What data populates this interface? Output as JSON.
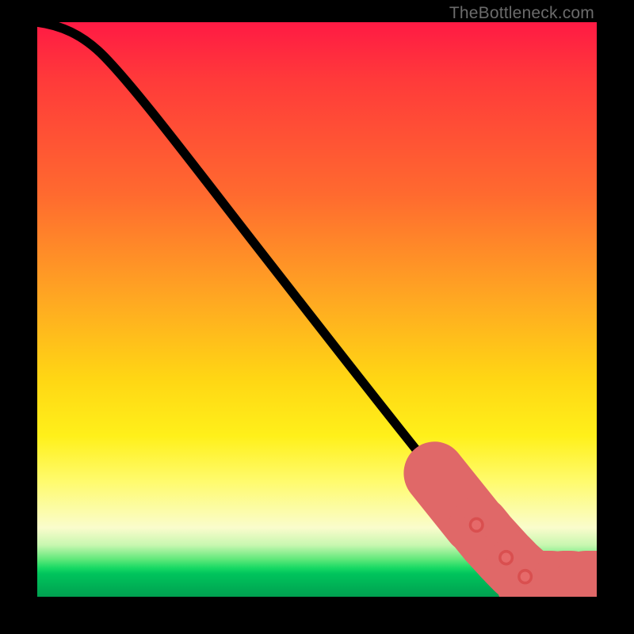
{
  "watermark": "TheBottleneck.com",
  "chart_data": {
    "type": "line",
    "title": "",
    "xlabel": "",
    "ylabel": "",
    "xlim": [
      0,
      100
    ],
    "ylim": [
      0,
      100
    ],
    "grid": false,
    "legend": false,
    "background": "rainbow-gradient-vertical",
    "curve": {
      "name": "bottleneck-curve",
      "points": [
        {
          "x": 0,
          "y": 100
        },
        {
          "x": 5,
          "y": 99
        },
        {
          "x": 10,
          "y": 96
        },
        {
          "x": 20,
          "y": 85
        },
        {
          "x": 35,
          "y": 65
        },
        {
          "x": 50,
          "y": 45
        },
        {
          "x": 65,
          "y": 27
        },
        {
          "x": 74,
          "y": 16
        },
        {
          "x": 83,
          "y": 6
        },
        {
          "x": 88,
          "y": 2
        },
        {
          "x": 100,
          "y": 2
        }
      ]
    },
    "highlighted_segments_on_curve": [
      {
        "x_start": 71,
        "x_end": 78
      },
      {
        "x_start": 79,
        "x_end": 80
      },
      {
        "x_start": 80.5,
        "x_end": 83.5
      },
      {
        "x_start": 84,
        "x_end": 85
      },
      {
        "x_start": 85.5,
        "x_end": 87
      }
    ],
    "flat_tail_markers": [
      {
        "x_start": 87.5,
        "x_end": 92,
        "y": 2
      },
      {
        "x_start": 94,
        "x_end": 95.5,
        "y": 2
      },
      {
        "x_start": 98,
        "x_end": 100,
        "y": 2
      }
    ]
  },
  "colors": {
    "marker": "#e66a6a",
    "curve": "#000000",
    "frame": "#000000"
  }
}
